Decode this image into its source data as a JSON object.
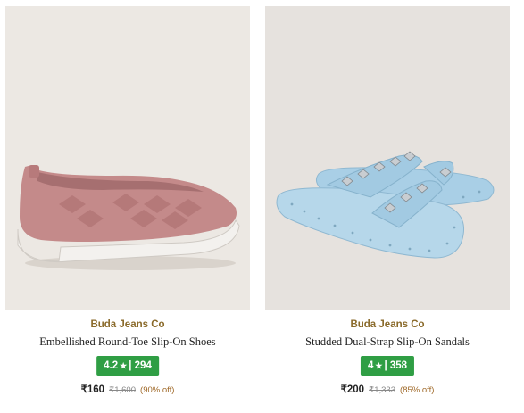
{
  "products": [
    {
      "brand": "Buda Jeans Co",
      "title": "Embellished Round-Toe Slip-On Shoes",
      "rating": "4.2",
      "star": "★",
      "rating_separator": "|",
      "reviews": "294",
      "price": "₹160",
      "mrp": "₹1,600",
      "discount": "(90% off)",
      "image_bg": "#ece8e3",
      "product_color": "#c48a8a"
    },
    {
      "brand": "Buda Jeans Co",
      "title": "Studded Dual-Strap Slip-On Sandals",
      "rating": "4",
      "star": "★",
      "rating_separator": "|",
      "reviews": "358",
      "price": "₹200",
      "mrp": "₹1,333",
      "discount": "(85% off)",
      "image_bg": "#e6e2de",
      "product_color": "#a9cfe6"
    }
  ],
  "colors": {
    "brand_text": "#8a6a2a",
    "rating_badge": "#2f9e44",
    "discount_text": "#a06a2a"
  }
}
